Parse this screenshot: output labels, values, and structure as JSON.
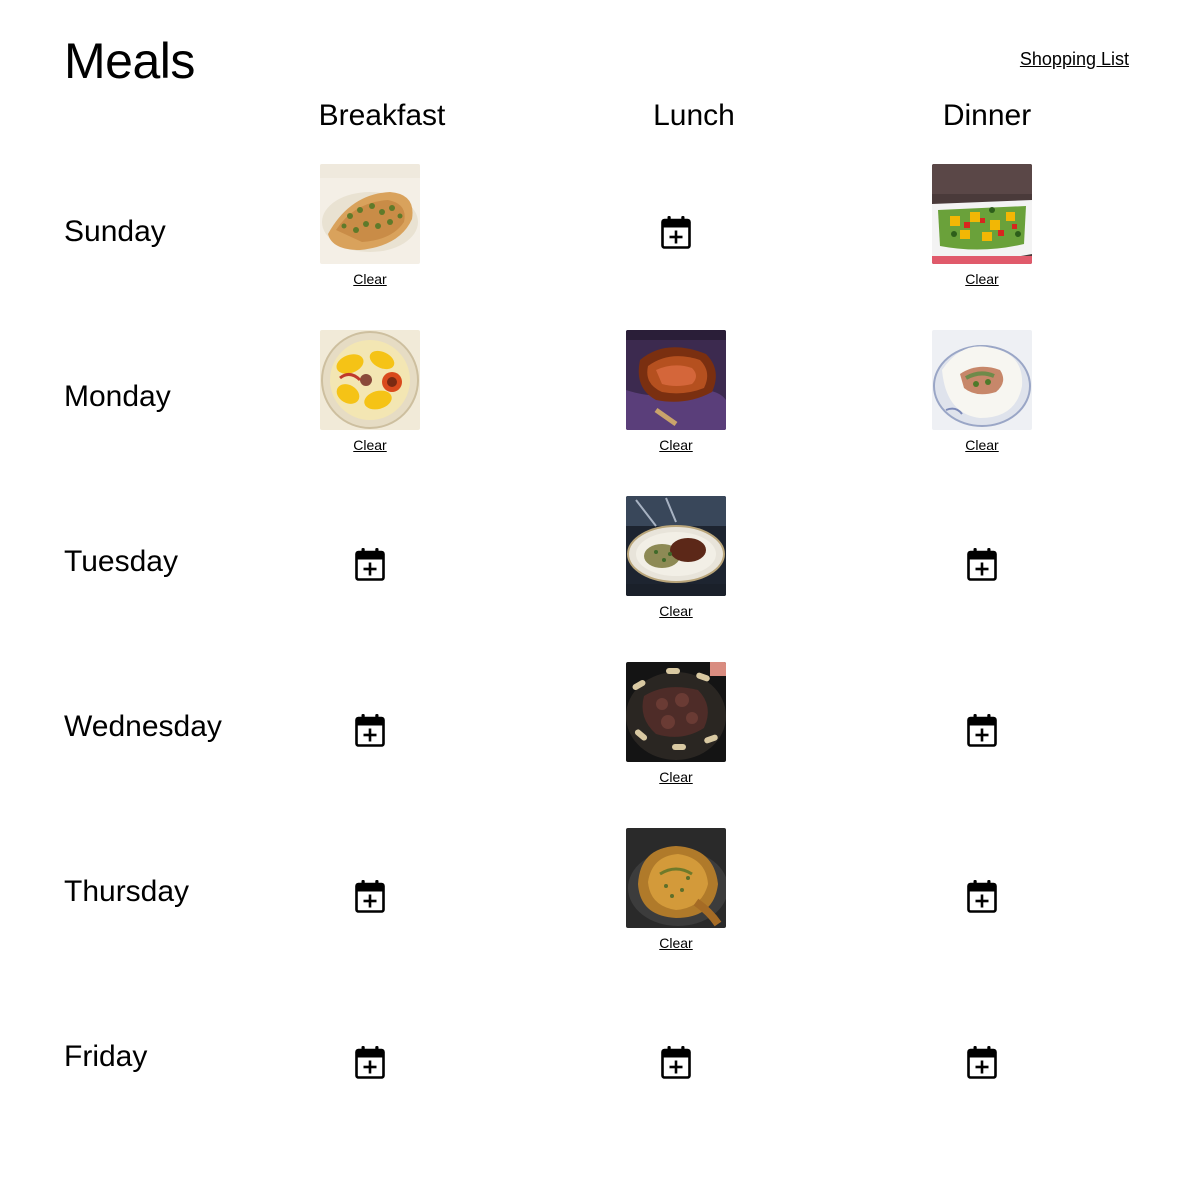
{
  "header": {
    "title": "Meals",
    "shopping_list_label": "Shopping List"
  },
  "columns": [
    "Breakfast",
    "Lunch",
    "Dinner"
  ],
  "clear_label": "Clear",
  "days": [
    {
      "name": "Sunday",
      "meals": [
        {
          "slot": "Breakfast",
          "state": "filled",
          "image": "chicken-capers-photo"
        },
        {
          "slot": "Lunch",
          "state": "empty",
          "icon": "calendar-plus-icon"
        },
        {
          "slot": "Dinner",
          "state": "filled",
          "image": "mango-salsa-photo"
        }
      ]
    },
    {
      "name": "Monday",
      "meals": [
        {
          "slot": "Breakfast",
          "state": "filled",
          "image": "corn-on-cob-photo"
        },
        {
          "slot": "Lunch",
          "state": "filled",
          "image": "roast-beef-photo"
        },
        {
          "slot": "Dinner",
          "state": "filled",
          "image": "fish-in-parchment-photo"
        }
      ]
    },
    {
      "name": "Tuesday",
      "meals": [
        {
          "slot": "Breakfast",
          "state": "empty",
          "icon": "calendar-plus-icon"
        },
        {
          "slot": "Lunch",
          "state": "filled",
          "image": "beef-and-spaetzle-photo"
        },
        {
          "slot": "Dinner",
          "state": "empty",
          "icon": "calendar-plus-icon"
        }
      ]
    },
    {
      "name": "Wednesday",
      "meals": [
        {
          "slot": "Breakfast",
          "state": "empty",
          "icon": "calendar-plus-icon"
        },
        {
          "slot": "Lunch",
          "state": "filled",
          "image": "beef-stroganoff-photo"
        },
        {
          "slot": "Dinner",
          "state": "empty",
          "icon": "calendar-plus-icon"
        }
      ]
    },
    {
      "name": "Thursday",
      "meals": [
        {
          "slot": "Breakfast",
          "state": "empty",
          "icon": "calendar-plus-icon"
        },
        {
          "slot": "Lunch",
          "state": "filled",
          "image": "roast-chicken-photo"
        },
        {
          "slot": "Dinner",
          "state": "empty",
          "icon": "calendar-plus-icon"
        }
      ]
    },
    {
      "name": "Friday",
      "meals": [
        {
          "slot": "Breakfast",
          "state": "empty",
          "icon": "calendar-plus-icon"
        },
        {
          "slot": "Lunch",
          "state": "empty",
          "icon": "calendar-plus-icon"
        },
        {
          "slot": "Dinner",
          "state": "empty",
          "icon": "calendar-plus-icon"
        }
      ]
    }
  ]
}
